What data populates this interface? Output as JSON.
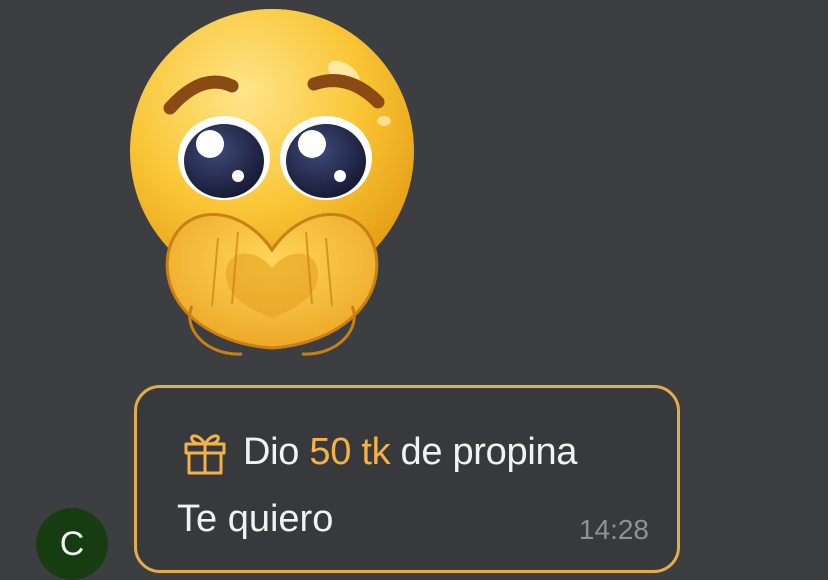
{
  "sticker": {
    "icon": "pleading-face-heart-hands-sticker"
  },
  "tip": {
    "icon": "gift-icon",
    "prefix": "Dio",
    "amount": "50 tk",
    "suffix": "de propina",
    "accent_color": "#f2b248"
  },
  "message": {
    "text": "Te quiero",
    "time": "14:28"
  },
  "avatar": {
    "initial": "C",
    "color": "#163d12"
  },
  "colors": {
    "background": "#3d3e42",
    "bubble_border": "#e3ad4a"
  }
}
